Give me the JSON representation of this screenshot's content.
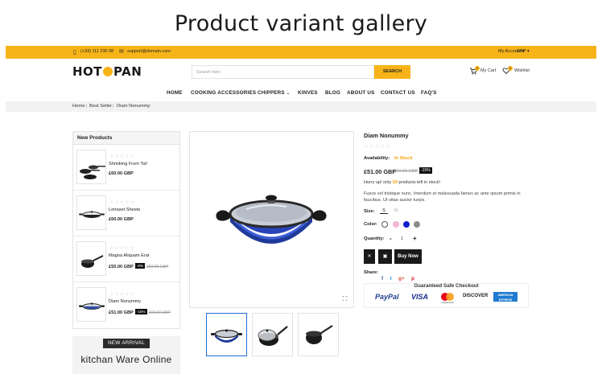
{
  "page_heading": "Product variant gallery",
  "topbar": {
    "phone": "(+33) 111 230 98",
    "email": "support@domain.com",
    "account": "My Account",
    "currency": "GBP"
  },
  "header": {
    "logo_left": "HOT",
    "logo_right": "PAN",
    "search_placeholder": "Search here",
    "search_button": "SEARCH",
    "cart_label": "My Cart",
    "cart_count": "0",
    "wishlist_label": "Wishlist",
    "wishlist_count": "0"
  },
  "nav": [
    "HOME",
    "COOKING ACCESSORIES",
    "CHIPPERS",
    "KINVES",
    "BLOG",
    "ABOUT US",
    "CONTACT US",
    "FAQ'S"
  ],
  "breadcrumb": [
    "Home",
    "Best Seller",
    "Diam Nonummy"
  ],
  "sidebar": {
    "title": "New Products",
    "items": [
      {
        "name": "Shrinking From Toil",
        "price": "£60.00 GBP",
        "old": "",
        "badge": ""
      },
      {
        "name": "Letraset Sheets",
        "price": "£60.00 GBP",
        "old": "",
        "badge": ""
      },
      {
        "name": "Magna Aliquam Erat",
        "price": "£55.00 GBP",
        "old": "£60.00 GBP",
        "badge": "-8%"
      },
      {
        "name": "Diam Nonummy",
        "price": "£51.00 GBP",
        "old": "£60.00 GBP",
        "badge": "-15%"
      }
    ]
  },
  "new_arrival": {
    "badge": "NEW ARRIVAL",
    "title": "kitchan Ware Online"
  },
  "product": {
    "title": "Diam Nonummy",
    "availability_label": "Availability:",
    "availability": "In Stock",
    "price": "£51.00 GBP",
    "old_price": "£60.00 GBP",
    "discount": "-15%",
    "hurry_prefix": "Hurry up! only",
    "hurry_count": "59",
    "hurry_suffix": "products left in stock!",
    "description": "Fusce vel tristique nunc. Interdum et malesuada fames ac ante ipsum primis in faucibus. Ut vitae auctor turpis.",
    "size_label": "Size:",
    "sizes": [
      "S",
      "XL"
    ],
    "color_label": "Color:",
    "colors": [
      "#ffffff",
      "#f2b6d2",
      "#1320c9",
      "#8a8a8a"
    ],
    "quantity_label": "Quantity:",
    "quantity": "1",
    "buy_label": "Buy Now",
    "share_label": "Share:",
    "share_icons": [
      "facebook-icon",
      "twitter-icon",
      "google-plus-icon",
      "pinterest-icon"
    ],
    "safe_title": "Guaranteed Safe Checkout",
    "payments": [
      "PayPal",
      "VISA",
      "mastercard",
      "DISCOVER",
      "AMERICAN EXPRESS"
    ],
    "accent": "#f7b418"
  }
}
